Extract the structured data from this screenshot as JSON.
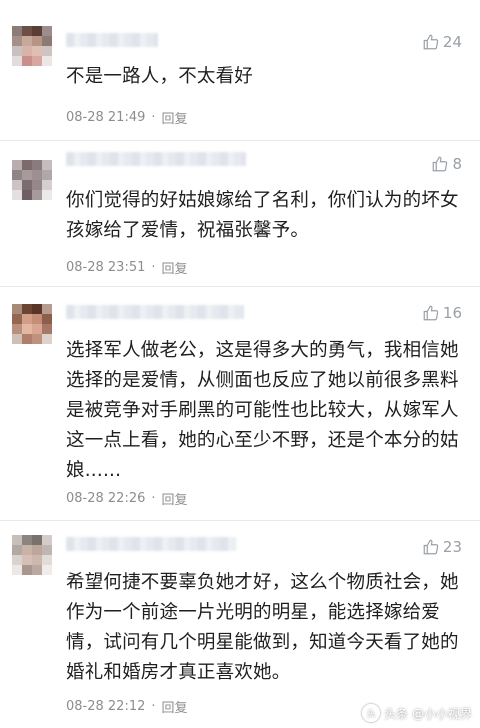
{
  "comments": [
    {
      "likes": "24",
      "text": "不是一路人，不太看好",
      "time": "08-28 21:49",
      "reply": "回复"
    },
    {
      "likes": "8",
      "text": "你们觉得的好姑娘嫁给了名利，你们认为的坏女孩嫁给了爱情，祝福张馨予。",
      "time": "08-28 23:51",
      "reply": "回复"
    },
    {
      "likes": "16",
      "text": "选择军人做老公，这是得多大的勇气，我相信她选择的是爱情，从侧面也反应了她以前很多黑料是被竞争对手刷黑的可能性也比较大，从嫁军人这一点上看，她的心至少不野，还是个本分的姑娘......",
      "time": "08-28 22:26",
      "reply": "回复"
    },
    {
      "likes": "23",
      "text": "希望何捷不要辜负她才好，这么个物质社会，她作为一个前途一片光明的明星，能选择嫁给爱情，试问有几个明星能做到，知道今天看了她的婚礼和婚房才真正喜欢她。",
      "time": "08-28 22:12",
      "reply": "回复"
    }
  ],
  "icons": {
    "like": "thumbs-up-icon",
    "watermark": "headline-logo-icon"
  },
  "watermark": {
    "text": "头条 @小小视界"
  },
  "colors": {
    "text": "#1f1f1f",
    "meta": "#8d8d8d",
    "like": "#9aa0a8",
    "divider": "#e9e9e9"
  }
}
